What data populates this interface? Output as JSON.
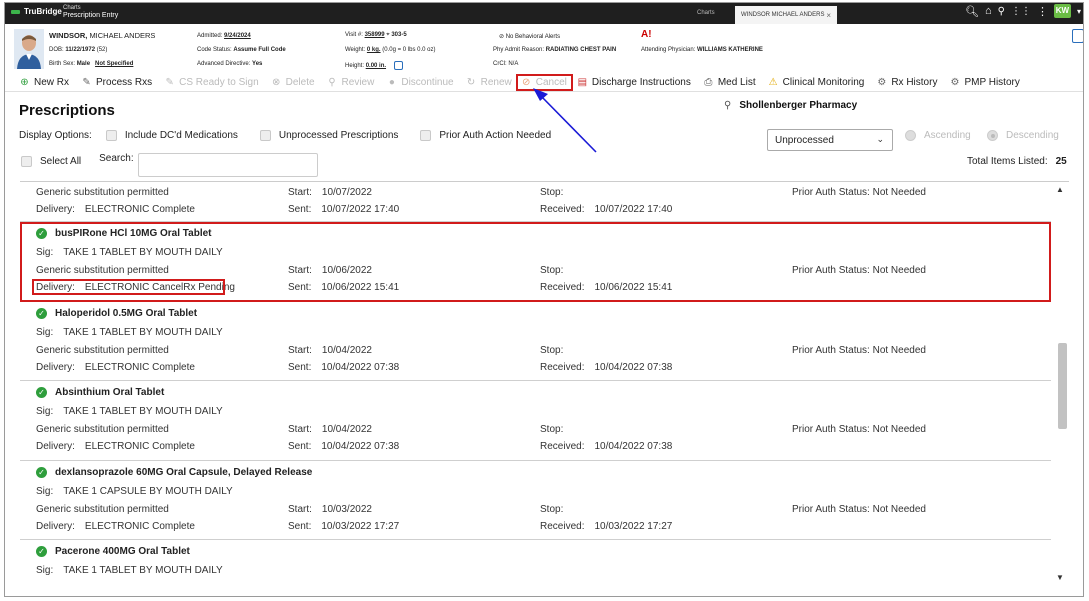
{
  "topbar": {
    "brand": "TruBridge",
    "app_small": "Charts",
    "app_title": "Prescription Entry",
    "charts_link": "Charts",
    "tab_label": "WINDSOR MICHAEL ANDERS",
    "tab_close": "×",
    "user_initials": "KW"
  },
  "patient": {
    "last_name": "WINDSOR,",
    "first_name": "MICHAEL ANDERS",
    "dob_label": "DOB:",
    "dob": "11/22/1972",
    "age": "(52)",
    "sex_label": "Birth Sex:",
    "sex": "Male",
    "sex_extra": "Not Specified",
    "admitted_label": "Admitted:",
    "admitted": "9/24/2024",
    "code_label": "Code Status:",
    "code": "Assume Full Code",
    "directive_label": "Advanced Directive:",
    "directive": "Yes",
    "visit_label": "Visit #:",
    "visit": "358999",
    "room": "303-5",
    "weight_label": "Weight:",
    "weight": "0 kg.",
    "weight_extra": "(0.0g = 0 lbs 0.0 oz)",
    "height_label": "Height:",
    "height": "0.00 in.",
    "behavior": "No Behavioral Alerts",
    "reason_label": "Phy Admit Reason:",
    "reason": "RADIATING CHEST PAIN",
    "crcl_label": "CrCl:",
    "crcl": "N/A",
    "physician_label": "Attending Physician:",
    "physician": "WILLIAMS KATHERINE"
  },
  "toolbar": {
    "new_rx": "New Rx",
    "process_rxs": "Process Rxs",
    "cs_ready": "CS Ready to Sign",
    "delete": "Delete",
    "review": "Review",
    "discontinue": "Discontinue",
    "renew": "Renew",
    "cancel": "Cancel",
    "discharge": "Discharge Instructions",
    "med_list": "Med List",
    "clinical": "Clinical Monitoring",
    "rx_history": "Rx History",
    "pmp_history": "PMP History"
  },
  "page": {
    "title": "Prescriptions",
    "pharmacy": "Shollenberger Pharmacy",
    "display_options": "Display Options:",
    "opt_include_dc": "Include DC'd Medications",
    "opt_unprocessed": "Unprocessed Prescriptions",
    "opt_prior_auth": "Prior Auth Action Needed",
    "filter_value": "Unprocessed",
    "ascending": "Ascending",
    "descending": "Descending",
    "select_all": "Select All",
    "search_label": "Search:",
    "total_label": "Total Items Listed:",
    "total_value": "25"
  },
  "labels": {
    "sig": "Sig:",
    "generic": "Generic substitution permitted",
    "delivery": "Delivery:",
    "start": "Start:",
    "stop": "Stop:",
    "sent": "Sent:",
    "received": "Received:",
    "prior_auth": "Prior Auth Status: Not Needed"
  },
  "rx_partial": {
    "start": "10/07/2022",
    "delivery": "ELECTRONIC Complete",
    "sent": "10/07/2022 17:40",
    "received": "10/07/2022 17:40"
  },
  "rx": [
    {
      "drug": "busPIRone HCl 10MG Oral Tablet",
      "sig": "TAKE 1 TABLET BY MOUTH DAILY",
      "start": "10/06/2022",
      "delivery": "ELECTRONIC CancelRx Pending",
      "sent": "10/06/2022 15:41",
      "received": "10/06/2022 15:41"
    },
    {
      "drug": "Haloperidol 0.5MG Oral Tablet",
      "sig": "TAKE 1 TABLET BY MOUTH DAILY",
      "start": "10/04/2022",
      "delivery": "ELECTRONIC Complete",
      "sent": "10/04/2022 07:38",
      "received": "10/04/2022 07:38"
    },
    {
      "drug": "Absinthium Oral Tablet",
      "sig": "TAKE 1 TABLET BY MOUTH DAILY",
      "start": "10/04/2022",
      "delivery": "ELECTRONIC Complete",
      "sent": "10/04/2022 07:38",
      "received": "10/04/2022 07:38"
    },
    {
      "drug": "dexlansoprazole 60MG Oral Capsule, Delayed Release",
      "sig": "TAKE 1 CAPSULE BY MOUTH DAILY",
      "start": "10/03/2022",
      "delivery": "ELECTRONIC Complete",
      "sent": "10/03/2022 17:27",
      "received": "10/03/2022 17:27"
    },
    {
      "drug": "Pacerone 400MG Oral Tablet",
      "sig": "TAKE 1 TABLET BY MOUTH DAILY",
      "start": "",
      "delivery": "",
      "sent": "",
      "received": ""
    }
  ],
  "colors": {
    "highlight": "#d11b1b",
    "arrow": "#1a1ad6",
    "check": "#2e9e3c"
  }
}
